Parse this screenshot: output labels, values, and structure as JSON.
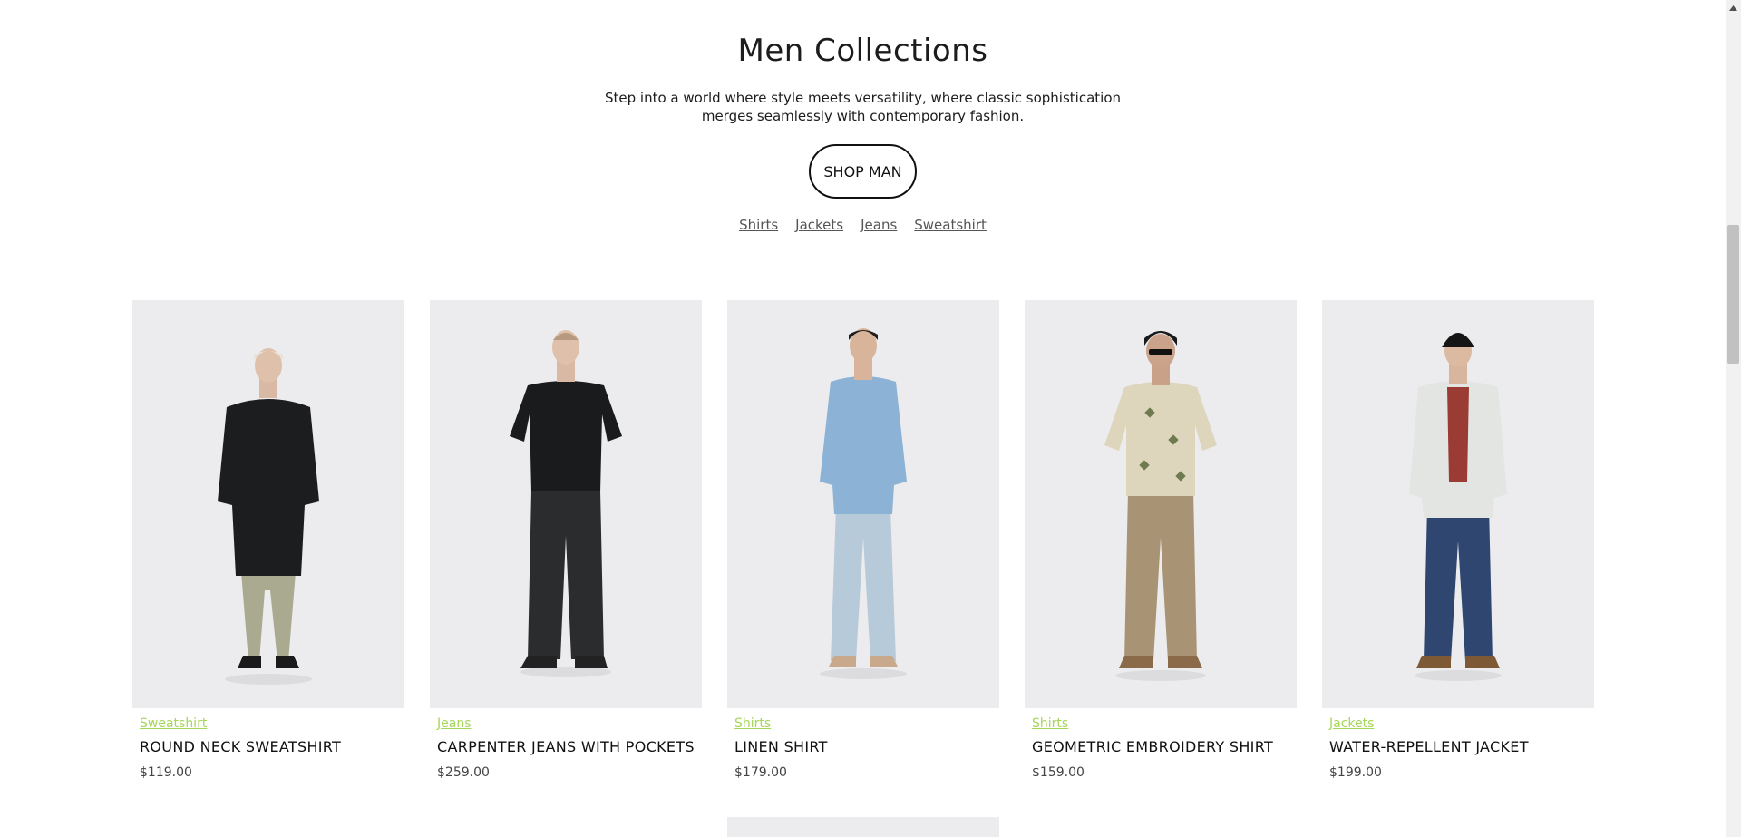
{
  "section": {
    "title": "Men Collections",
    "subtitle_line1": "Step into a world where style meets versatility, where classic sophistication",
    "subtitle_line2": "merges seamlessly with contemporary fashion.",
    "shop_button": "SHOP MAN"
  },
  "category_links": [
    "Shirts",
    "Jackets",
    "Jeans",
    "Sweatshirt"
  ],
  "products": [
    {
      "category": "Sweatshirt",
      "name": "ROUND NECK SWEATSHIRT",
      "price": "$119.00",
      "image": "man-black-sweatshirt-khaki-pants"
    },
    {
      "category": "Jeans",
      "name": "CARPENTER JEANS WITH POCKETS",
      "price": "$259.00",
      "image": "man-black-tshirt-black-jeans"
    },
    {
      "category": "Shirts",
      "name": "LINEN SHIRT",
      "price": "$179.00",
      "image": "man-blue-linen-shirt-light-jeans"
    },
    {
      "category": "Shirts",
      "name": "GEOMETRIC EMBROIDERY SHIRT",
      "price": "$159.00",
      "image": "man-beige-embroidered-shirt-tan-pants"
    },
    {
      "category": "Jackets",
      "name": "WATER-REPELLENT JACKET",
      "price": "$199.00",
      "image": "man-white-jacket-blue-jeans"
    }
  ],
  "colors": {
    "accent": "#a6d65a",
    "text": "#1c1c1c",
    "photo_bg": "#ececee"
  }
}
